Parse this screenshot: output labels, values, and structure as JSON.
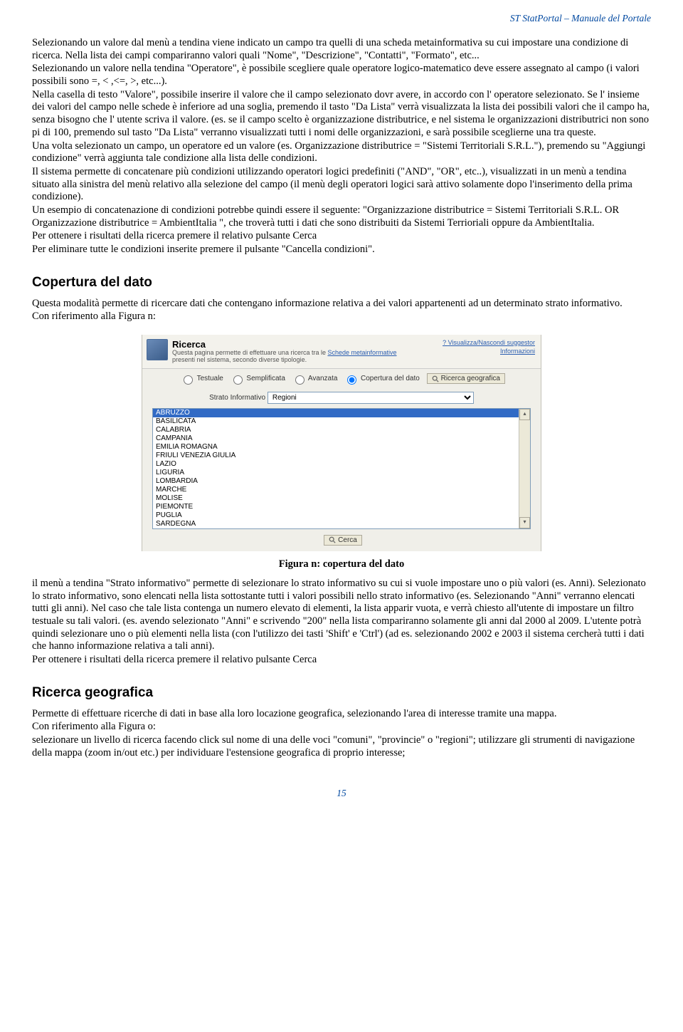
{
  "header": "ST StatPortal – Manuale del Portale",
  "para1": "Selezionando un valore dal menù a tendina viene indicato un campo tra quelli di una scheda metainformativa su cui impostare una condizione di ricerca. Nella lista dei campi compariranno valori quali \"Nome\", \"Descrizione\", \"Contatti\", \"Formato\", etc...",
  "para2": "Selezionando un valore nella tendina \"Operatore\", è possibile scegliere quale operatore logico-matematico deve essere assegnato al campo (i valori possibili sono =, < ,<=, >, etc...).",
  "para3": "Nella casella di testo \"Valore\", possibile inserire il valore che il campo selezionato dovr avere, in accordo con l' operatore selezionato. Se l' insieme dei valori del campo nelle schede è inferiore ad una soglia, premendo il tasto \"Da Lista\" verrà visualizzata la lista dei possibili valori che il campo ha, senza bisogno che l' utente scriva il valore. (es. se il campo scelto è organizzazione distributrice, e nel sistema le organizzazioni distributrici non sono pi di 100, premendo sul tasto \"Da Lista\" verranno visualizzati tutti i nomi delle organizzazioni, e sarà possibile sceglierne una tra queste.",
  "para4": "Una volta selezionato un campo, un operatore ed un valore (es. Organizzazione distributrice = \"Sistemi Territoriali S.R.L.\"), premendo su \"Aggiungi condizione\" verrà aggiunta tale condizione alla lista delle condizioni.",
  "para5": "Il sistema permette di concatenare più condizioni utilizzando operatori logici predefiniti (\"AND\", \"OR\", etc..), visualizzati in un menù a tendina situato alla sinistra del menù relativo alla selezione del campo (il menù degli operatori logici sarà attivo solamente dopo l'inserimento della prima condizione).",
  "para6": "Un esempio di concatenazione di condizioni potrebbe quindi essere il seguente: \"Organizzazione distributrice = Sistemi Territoriali S.R.L. OR  Organizzazione distributrice = AmbientItalia \", che troverà tutti i dati che sono distribuiti da Sistemi Terrioriali oppure da AmbientItalia.",
  "para7": "Per ottenere i risultati della ricerca premere il relativo pulsante Cerca",
  "para8": "Per eliminare tutte le condizioni inserite premere il pulsante \"Cancella condizioni\".",
  "section1_title": "Copertura del dato",
  "section1_p1": "Questa modalità permette di ricercare dati che contengano informazione relativa a dei valori appartenenti ad un determinato strato informativo.",
  "section1_p2": "Con riferimento alla Figura n:",
  "figure": {
    "title": "Ricerca",
    "subtitle_pre": "Questa pagina permette di effettuare una ricerca tra le ",
    "subtitle_link": "Schede metainformative",
    "subtitle_post": " presenti nel sistema, secondo diverse tipologie.",
    "toplink1": "Visualizza/Nascondi suggestor",
    "toplink2": "Informazioni",
    "radio": {
      "r1": "Testuale",
      "r2": "Semplificata",
      "r3": "Avanzata",
      "r4": "Copertura del dato",
      "btn": "Ricerca geografica"
    },
    "strato_label": "Strato Informativo",
    "strato_value": "Regioni",
    "list": [
      "ABRUZZO",
      "BASILICATA",
      "CALABRIA",
      "CAMPANIA",
      "EMILIA ROMAGNA",
      "FRIULI VENEZIA GIULIA",
      "LAZIO",
      "LIGURIA",
      "LOMBARDIA",
      "MARCHE",
      "MOLISE",
      "PIEMONTE",
      "PUGLIA",
      "SARDEGNA"
    ],
    "cerca": "Cerca"
  },
  "figure_caption": "Figura n: copertura del dato",
  "after_fig_p1": "il menù a tendina \"Strato informativo\" permette di selezionare lo strato informativo su cui si vuole impostare uno o più valori (es. Anni). Selezionato lo strato informativo, sono elencati nella lista sottostante tutti i valori possibili nello strato informativo (es. Selezionando \"Anni\" verranno elencati tutti gli anni). Nel caso che tale lista contenga un numero elevato di elementi, la lista apparir vuota, e verrà chiesto all'utente di impostare un filtro testuale su tali valori. (es. avendo selezionato \"Anni\" e scrivendo \"200\" nella lista compariranno solamente gli anni dal 2000 al 2009. L'utente potrà quindi selezionare uno o più elementi nella lista (con l'utilizzo dei tasti 'Shift' e 'Ctrl') (ad es. selezionando 2002 e 2003 il sistema cercherà tutti i dati che hanno informazione relativa a tali anni).",
  "after_fig_p2": "Per ottenere i risultati della ricerca premere il relativo pulsante Cerca",
  "section2_title": "Ricerca geografica",
  "section2_p1": "Permette di effettuare ricerche di dati in base alla loro locazione geografica, selezionando l'area di interesse tramite una mappa.",
  "section2_p2": "Con riferimento alla Figura o:",
  "section2_p3": "selezionare un livello di ricerca facendo click sul nome di una delle voci \"comuni\", \"provincie\" o \"regioni\"; utilizzare gli strumenti di navigazione della mappa (zoom in/out etc.) per individuare l'estensione geografica di proprio interesse;",
  "page_number": "15"
}
